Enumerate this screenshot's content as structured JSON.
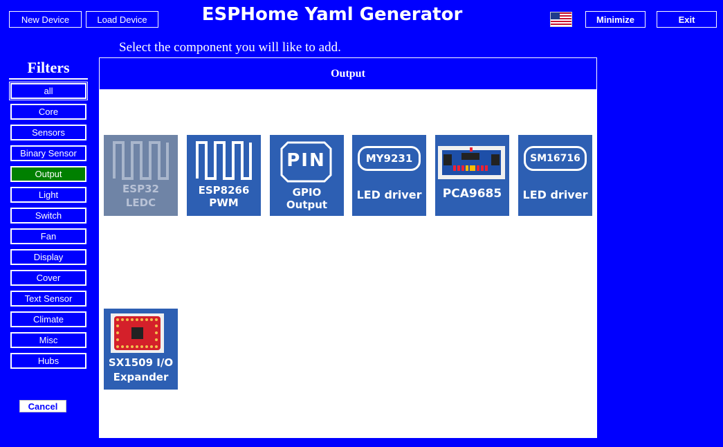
{
  "header": {
    "new_device": "New Device",
    "load_device": "Load Device",
    "title": "ESPHome Yaml Generator",
    "minimize": "Minimize",
    "exit": "Exit"
  },
  "prompt": "Select the component you will like to add.",
  "filters": {
    "title": "Filters",
    "items": [
      "all",
      "Core",
      "Sensors",
      "Binary Sensor",
      "Output",
      "Light",
      "Switch",
      "Fan",
      "Display",
      "Cover",
      "Text Sensor",
      "Climate",
      "Misc",
      "Hubs"
    ],
    "active": "Output"
  },
  "cancel": "Cancel",
  "panel": {
    "title": "Output",
    "components": [
      {
        "line1": "ESP32",
        "line2": "LEDC",
        "icon": "square-wave-icon",
        "disabled": true
      },
      {
        "line1": "ESP8266",
        "line2": "PWM",
        "icon": "square-wave-icon"
      },
      {
        "icon_text": "PIN",
        "line1": "GPIO",
        "line2": "Output",
        "icon": "pin-icon"
      },
      {
        "chip": "MY9231",
        "label": "LED driver",
        "icon": "chip-label-icon"
      },
      {
        "label": "PCA9685",
        "icon": "pca9685-board-image"
      },
      {
        "chip": "SM16716",
        "label": "LED driver",
        "icon": "chip-label-icon"
      },
      {
        "line1": "SX1509  I/O",
        "line2": "Expander",
        "icon": "sx1509-board-image"
      }
    ]
  },
  "colors": {
    "background": "#0000ff",
    "tile": "#2d5fb3",
    "tile_disabled": "#6f84a6",
    "active_filter": "#008000"
  }
}
